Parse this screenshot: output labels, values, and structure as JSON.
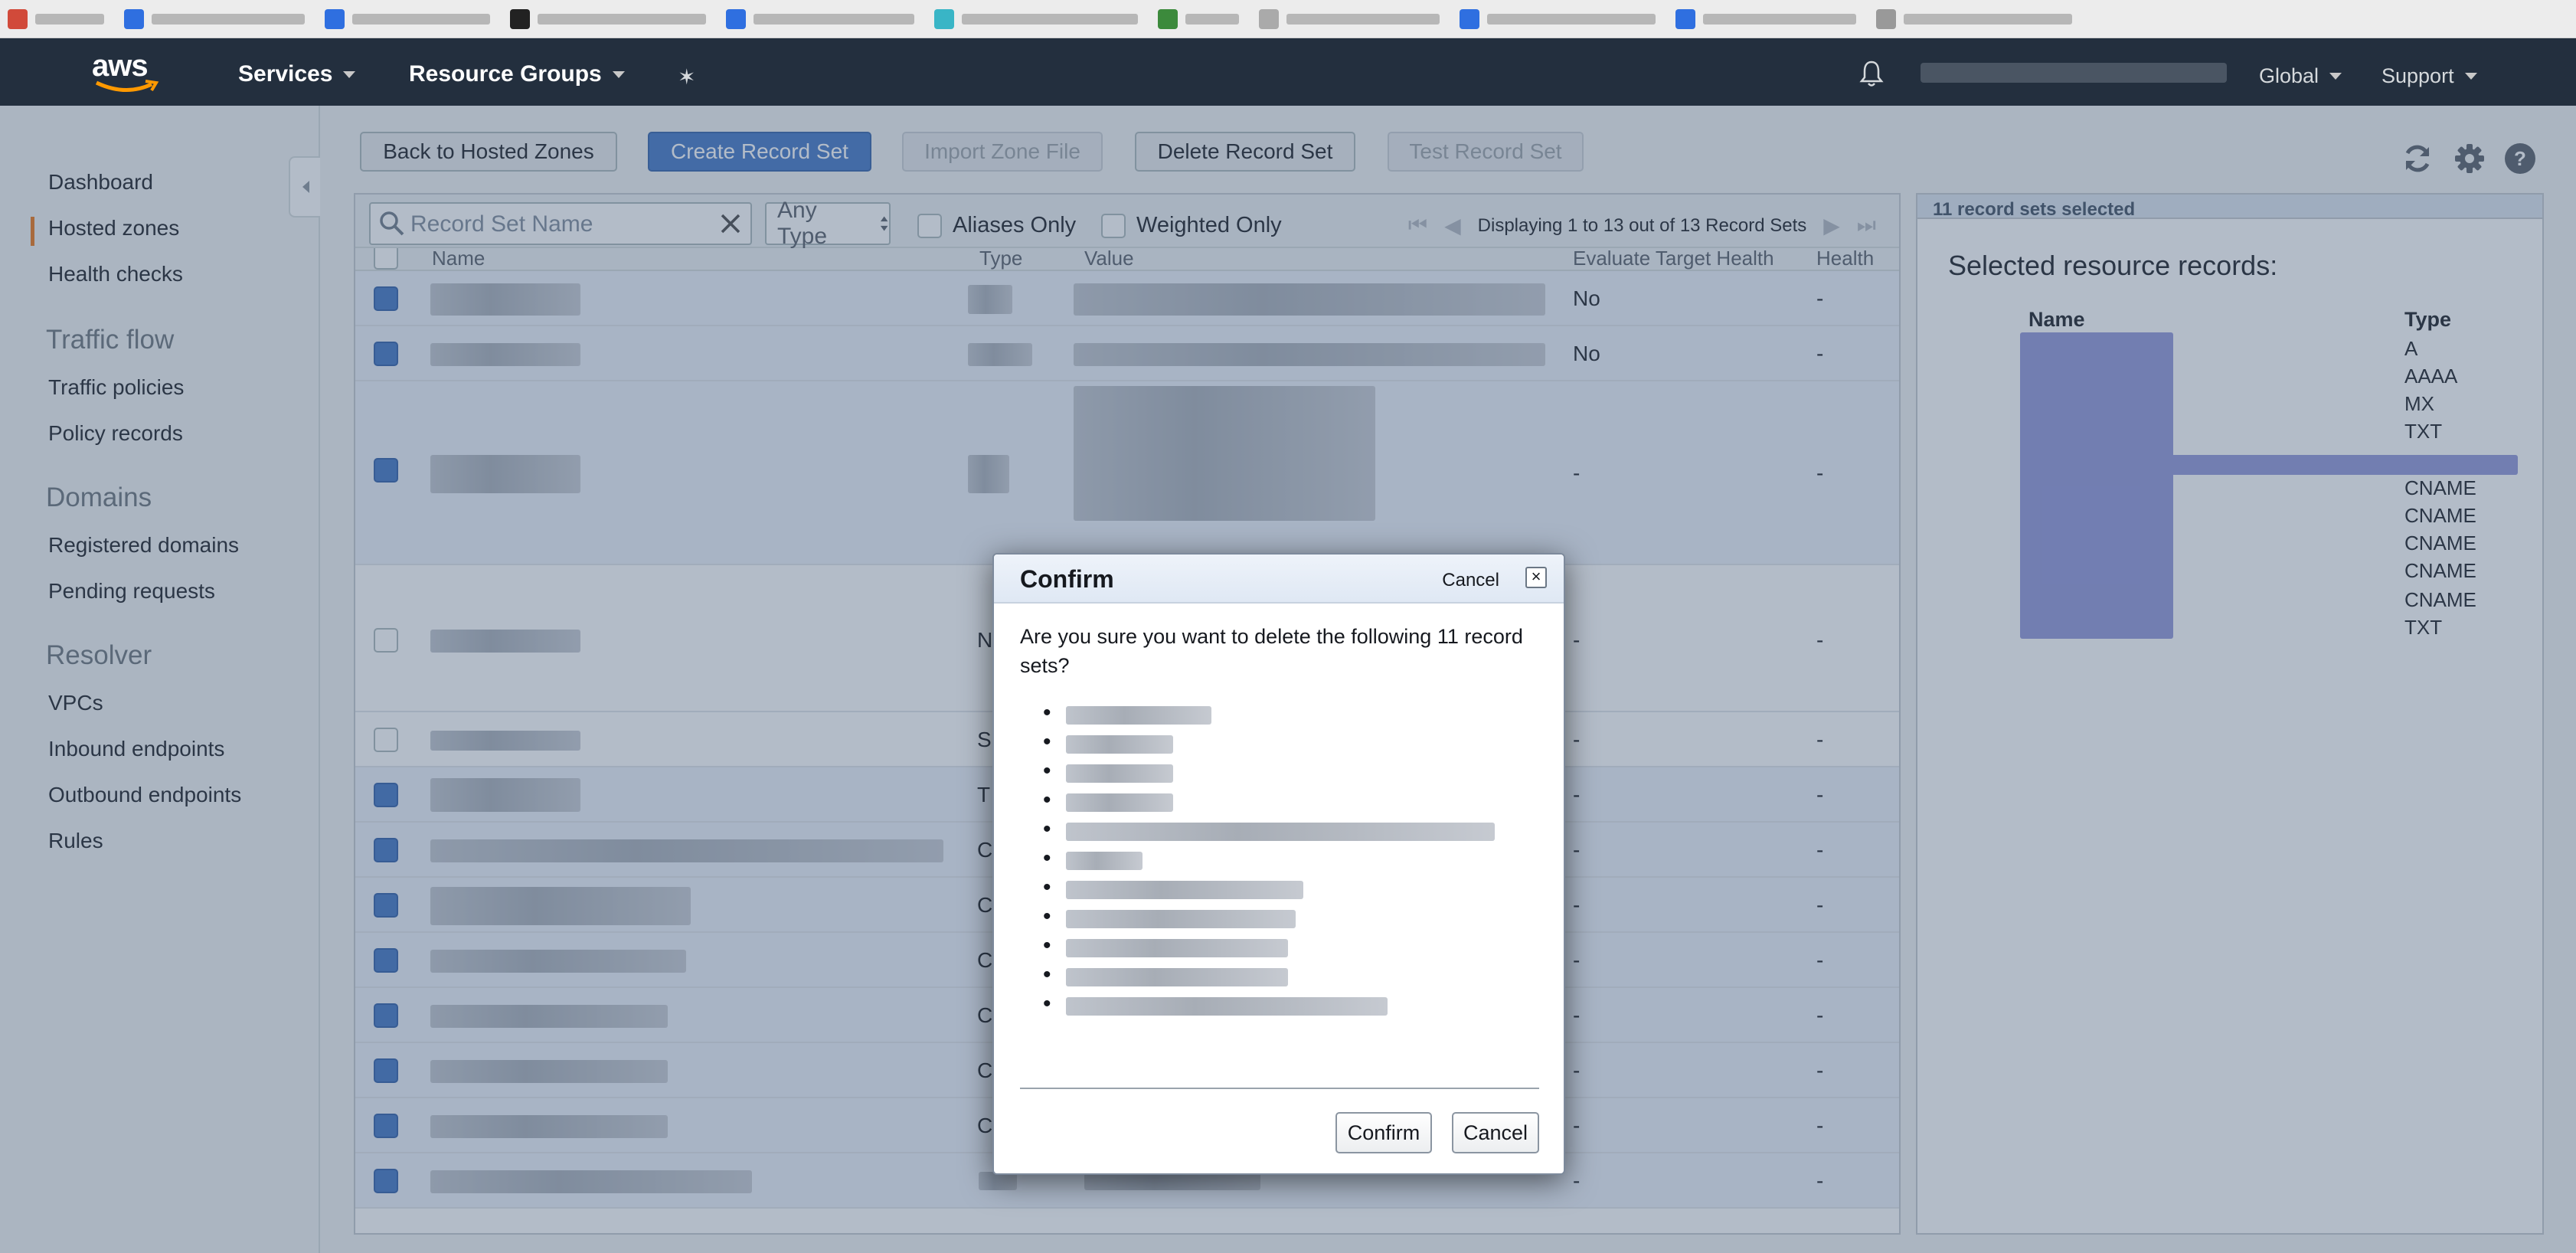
{
  "nav": {
    "logo": "aws",
    "services": "Services",
    "resource_groups": "Resource Groups",
    "global": "Global",
    "support": "Support"
  },
  "sidebar": {
    "items": [
      {
        "label": "Dashboard"
      },
      {
        "label": "Hosted zones"
      },
      {
        "label": "Health checks"
      }
    ],
    "traffic_flow": {
      "heading": "Traffic flow",
      "items": [
        "Traffic policies",
        "Policy records"
      ]
    },
    "domains": {
      "heading": "Domains",
      "items": [
        "Registered domains",
        "Pending requests"
      ]
    },
    "resolver": {
      "heading": "Resolver",
      "items": [
        "VPCs",
        "Inbound endpoints",
        "Outbound endpoints",
        "Rules"
      ]
    }
  },
  "toolbar": {
    "back": "Back to Hosted Zones",
    "create": "Create Record Set",
    "import": "Import Zone File",
    "delete": "Delete Record Set",
    "test": "Test Record Set"
  },
  "filter": {
    "search_placeholder": "Record Set Name",
    "type": "Any Type",
    "aliases": "Aliases Only",
    "weighted": "Weighted Only",
    "display": "Displaying 1 to 13 out of 13 Record Sets"
  },
  "table": {
    "columns": [
      "Name",
      "Type",
      "Value",
      "Evaluate Target Health",
      "Health Ch"
    ],
    "rows": [
      {
        "type": "",
        "value": "",
        "eth": "No",
        "health": "-"
      },
      {
        "type": "",
        "value": "",
        "eth": "No",
        "health": "-"
      },
      {
        "type": "",
        "value": "",
        "eth": "-",
        "health": "-"
      },
      {
        "type": "N",
        "value": "",
        "eth": "-",
        "health": "-"
      },
      {
        "type": "S",
        "value": "",
        "eth": "-",
        "health": "-"
      },
      {
        "type": "T",
        "value": "",
        "eth": "-",
        "health": "-"
      },
      {
        "type": "C",
        "value": "",
        "eth": "-",
        "health": "-"
      },
      {
        "type": "C",
        "value": "",
        "eth": "-",
        "health": "-"
      },
      {
        "type": "C",
        "value": "",
        "eth": "-",
        "health": "-"
      },
      {
        "type": "C",
        "value": "",
        "eth": "-",
        "health": "-"
      },
      {
        "type": "C",
        "value": "",
        "eth": "-",
        "health": "-"
      },
      {
        "type": "C",
        "value": "",
        "eth": "-",
        "health": "-"
      },
      {
        "type": "",
        "value": "",
        "eth": "-",
        "health": "-"
      }
    ]
  },
  "right_panel": {
    "header": "11 record sets selected",
    "title": "Selected resource records:",
    "col_name": "Name",
    "col_type": "Type",
    "types": [
      "A",
      "AAAA",
      "MX",
      "TXT",
      "",
      "CNAME",
      "CNAME",
      "CNAME",
      "CNAME",
      "CNAME",
      "TXT"
    ]
  },
  "modal": {
    "title": "Confirm",
    "cancel_link": "Cancel",
    "close": "×",
    "message": "Are you sure you want to delete the following 11 record sets?",
    "confirm": "Confirm",
    "cancel": "Cancel"
  }
}
